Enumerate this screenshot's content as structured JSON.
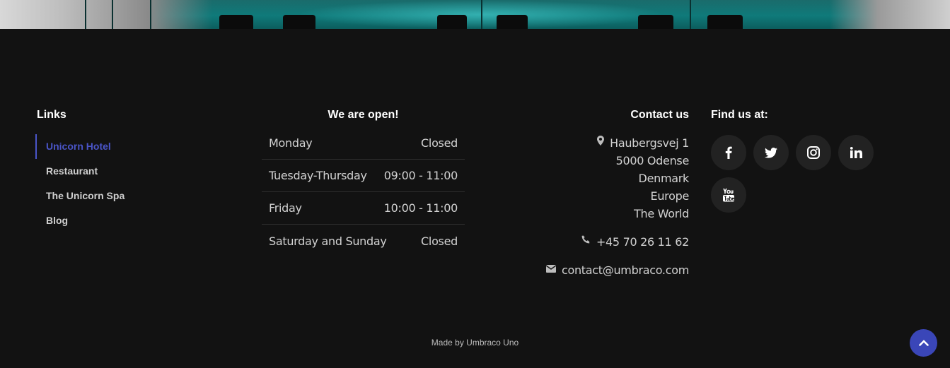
{
  "links": {
    "title": "Links",
    "items": [
      {
        "label": "Unicorn Hotel"
      },
      {
        "label": "Restaurant"
      },
      {
        "label": "The Unicorn Spa"
      },
      {
        "label": "Blog"
      }
    ]
  },
  "hours": {
    "title": "We are open!",
    "rows": [
      {
        "day": "Monday",
        "time": "Closed"
      },
      {
        "day": "Tuesday-Thursday",
        "time": "09:00 - 11:00"
      },
      {
        "day": "Friday",
        "time": "10:00 - 11:00"
      },
      {
        "day": "Saturday and Sunday",
        "time": "Closed"
      }
    ]
  },
  "contact": {
    "title": "Contact us",
    "address": [
      "Haubergsvej 1",
      "5000 Odense",
      "Denmark",
      "Europe",
      "The World"
    ],
    "phone": "+45 70 26 11 62",
    "email": "contact@umbraco.com"
  },
  "social": {
    "title": "Find us at:",
    "icons": [
      "facebook-icon",
      "twitter-icon",
      "instagram-icon",
      "linkedin-icon",
      "youtube-icon"
    ]
  },
  "footer": {
    "made_by": "Made by Umbraco Uno"
  },
  "colors": {
    "background": "#121212",
    "accent": "#3a46b8",
    "active_link": "#4a55c8"
  }
}
